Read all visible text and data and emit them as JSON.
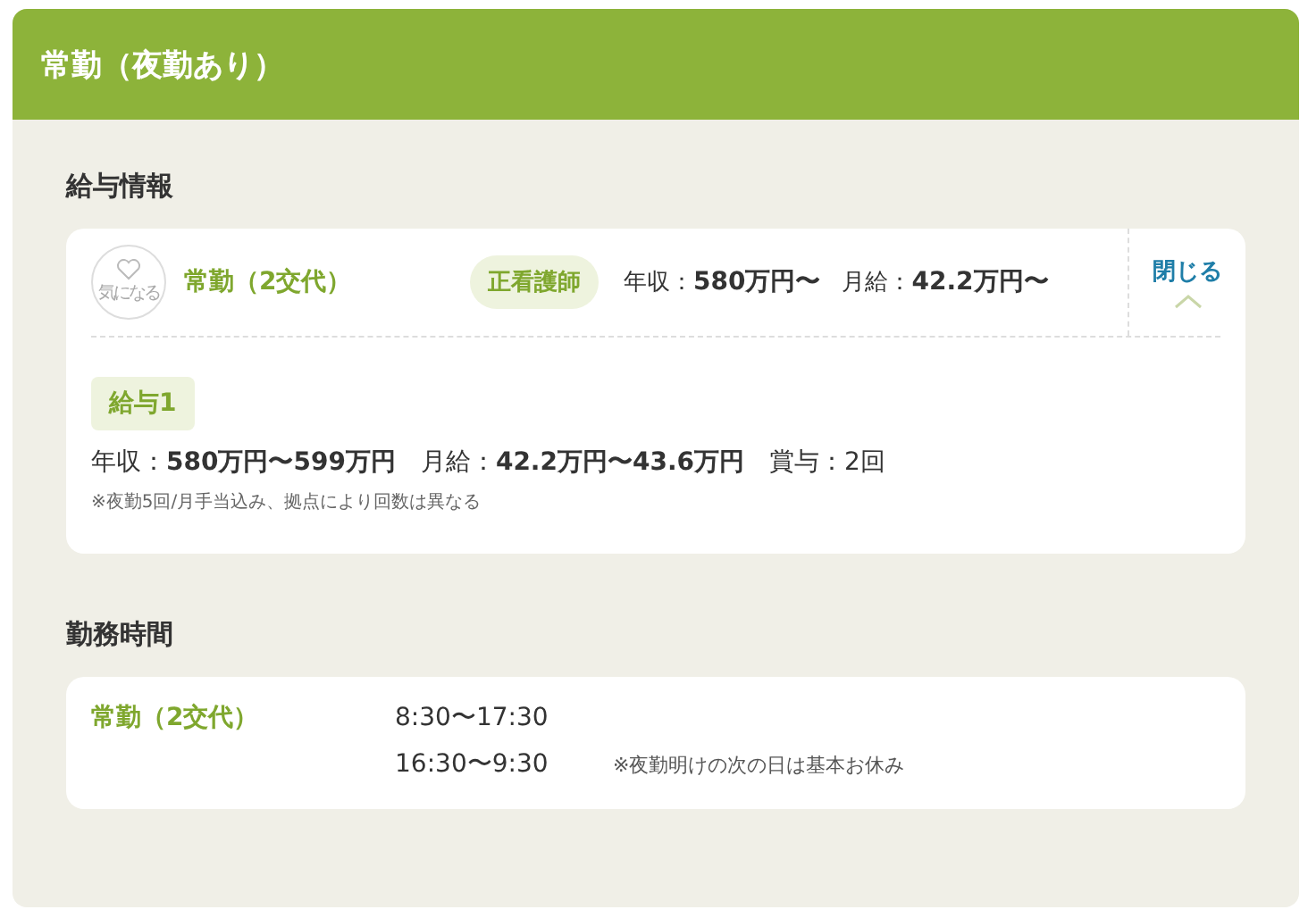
{
  "header": {
    "title": "常勤（夜勤あり）"
  },
  "salary_section": {
    "title": "給与情報",
    "card": {
      "favorite_label": "気になる",
      "favorite": false,
      "job_type": "常勤（2交代）",
      "tag": "正看護師",
      "summary": [
        "年収：**580万円〜**",
        "月給：**42.2万円〜**"
      ],
      "toggle": {
        "label": "閉じる",
        "expanded": true
      },
      "details": [
        {
          "badge": "給与1",
          "items": [
            "年収：**580万円〜599万円**",
            "月給：**42.2万円〜43.6万円**",
            "賞与：2回"
          ],
          "note": "※夜勤5回/月手当込み、拠点により回数は異なる"
        }
      ]
    }
  },
  "hours_section": {
    "title": "勤務時間",
    "rows": [
      {
        "label": "常勤（2交代）",
        "times": [
          {
            "time": "8:30〜17:30"
          },
          {
            "time": "16:30〜9:30",
            "note": "※夜勤明けの次の日は基本お休み"
          }
        ]
      }
    ]
  }
}
